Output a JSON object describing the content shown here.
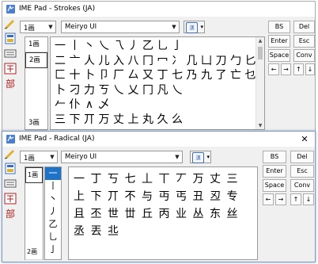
{
  "window1": {
    "title": "IME Pad - Strokes (JA)",
    "stroke_dropdown": "1画",
    "font_dropdown": "Meiryo UI",
    "conv_glyph": "漢",
    "keys": {
      "bs": "BS",
      "del": "Del",
      "enter": "Enter",
      "esc": "Esc",
      "space": "Space",
      "conv": "Conv",
      "left": "←",
      "right": "→",
      "up": "↑",
      "down": "↓"
    },
    "strokes": [
      "1画",
      "2画",
      "3画"
    ],
    "chars": [
      [
        "一",
        "丨",
        "丶",
        "乀",
        "乁",
        "丿",
        "乙",
        "乚",
        "亅"
      ],
      [
        "二",
        "亠",
        "人",
        "儿",
        "入",
        "八",
        "冂",
        "冖",
        "冫",
        "几",
        "凵",
        "刀",
        "勹",
        "匕",
        "匚",
        "十",
        "卜",
        "卩",
        "厂",
        "厶",
        "又",
        "丁",
        "七",
        "乃",
        "九",
        "了",
        "亡",
        "乜",
        "卜",
        "刁",
        "力",
        "ㄎ",
        "乀",
        "乂",
        "冂",
        "凡",
        "乀"
      ],
      [
        "𠂉",
        "仆",
        "∧",
        "乄"
      ],
      [
        "三",
        "下",
        "丌",
        "万",
        "丈",
        "上",
        "丸",
        "久",
        "么"
      ]
    ]
  },
  "window2": {
    "title": "IME Pad - Radical (JA)",
    "stroke_dropdown": "1画",
    "font_dropdown": "Meiryo UI",
    "conv_glyph": "漢",
    "keys": {
      "bs": "BS",
      "del": "Del",
      "enter": "Enter",
      "esc": "Esc",
      "space": "Space",
      "conv": "Conv",
      "left": "←",
      "right": "→",
      "up": "↑",
      "down": "↓"
    },
    "strokes": [
      "1画",
      "2画"
    ],
    "radicals": [
      "一",
      "丨",
      "丶",
      "丿",
      "乙",
      "乚",
      "亅"
    ],
    "chars": [
      [
        "一",
        "丁",
        "丂",
        "七",
        "丄",
        "丅",
        "丆",
        "万",
        "丈",
        "三"
      ],
      [
        "上",
        "下",
        "丌",
        "不",
        "与",
        "丏",
        "丐",
        "丑",
        "丒",
        "专"
      ],
      [
        "且",
        "丕",
        "世",
        "丗",
        "丘",
        "丙",
        "业",
        "丛",
        "东",
        "丝"
      ],
      [
        "丞",
        "丟",
        "丠"
      ]
    ]
  }
}
